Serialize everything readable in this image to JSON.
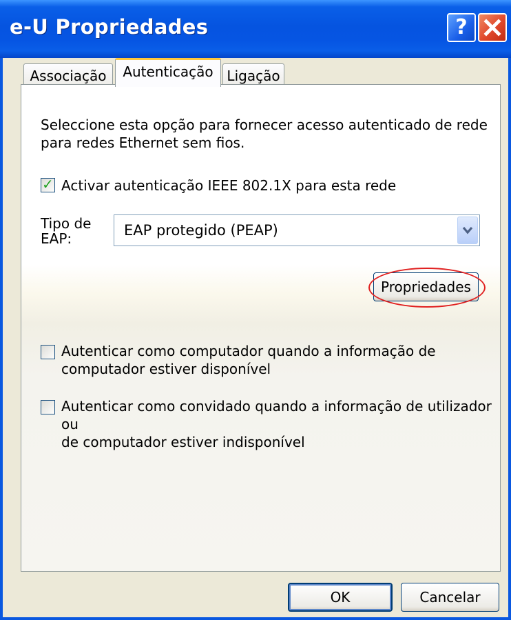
{
  "window": {
    "title": "e-U Propriedades"
  },
  "tabs": [
    {
      "label": "Associação",
      "selected": false
    },
    {
      "label": "Autenticação",
      "selected": true
    },
    {
      "label": "Ligação",
      "selected": false
    }
  ],
  "panel": {
    "description": "Seleccione esta opção para fornecer acesso autenticado de rede para redes Ethernet sem fios.",
    "enable_8021x": {
      "label": "Activar autenticação IEEE 802.1X para esta rede",
      "checked": true
    },
    "eap_type": {
      "label_line1": "Tipo de",
      "label_line2": "EAP:",
      "value": "EAP protegido (PEAP)"
    },
    "properties_button": "Propriedades",
    "auth_computer": {
      "line1": "Autenticar como computador quando a informação de",
      "line2": "computador estiver disponível",
      "checked": false
    },
    "auth_guest": {
      "line1": "Autenticar como convidado quando a informação de utilizador ou",
      "line2": "de computador estiver indisponível",
      "checked": false
    }
  },
  "footer": {
    "ok_label": "OK",
    "cancel_label": "Cancelar"
  },
  "colors": {
    "titlebar": "#0554e0",
    "accent_tab": "#ffc83c",
    "annotation": "#e02020",
    "check": "#21a121"
  }
}
